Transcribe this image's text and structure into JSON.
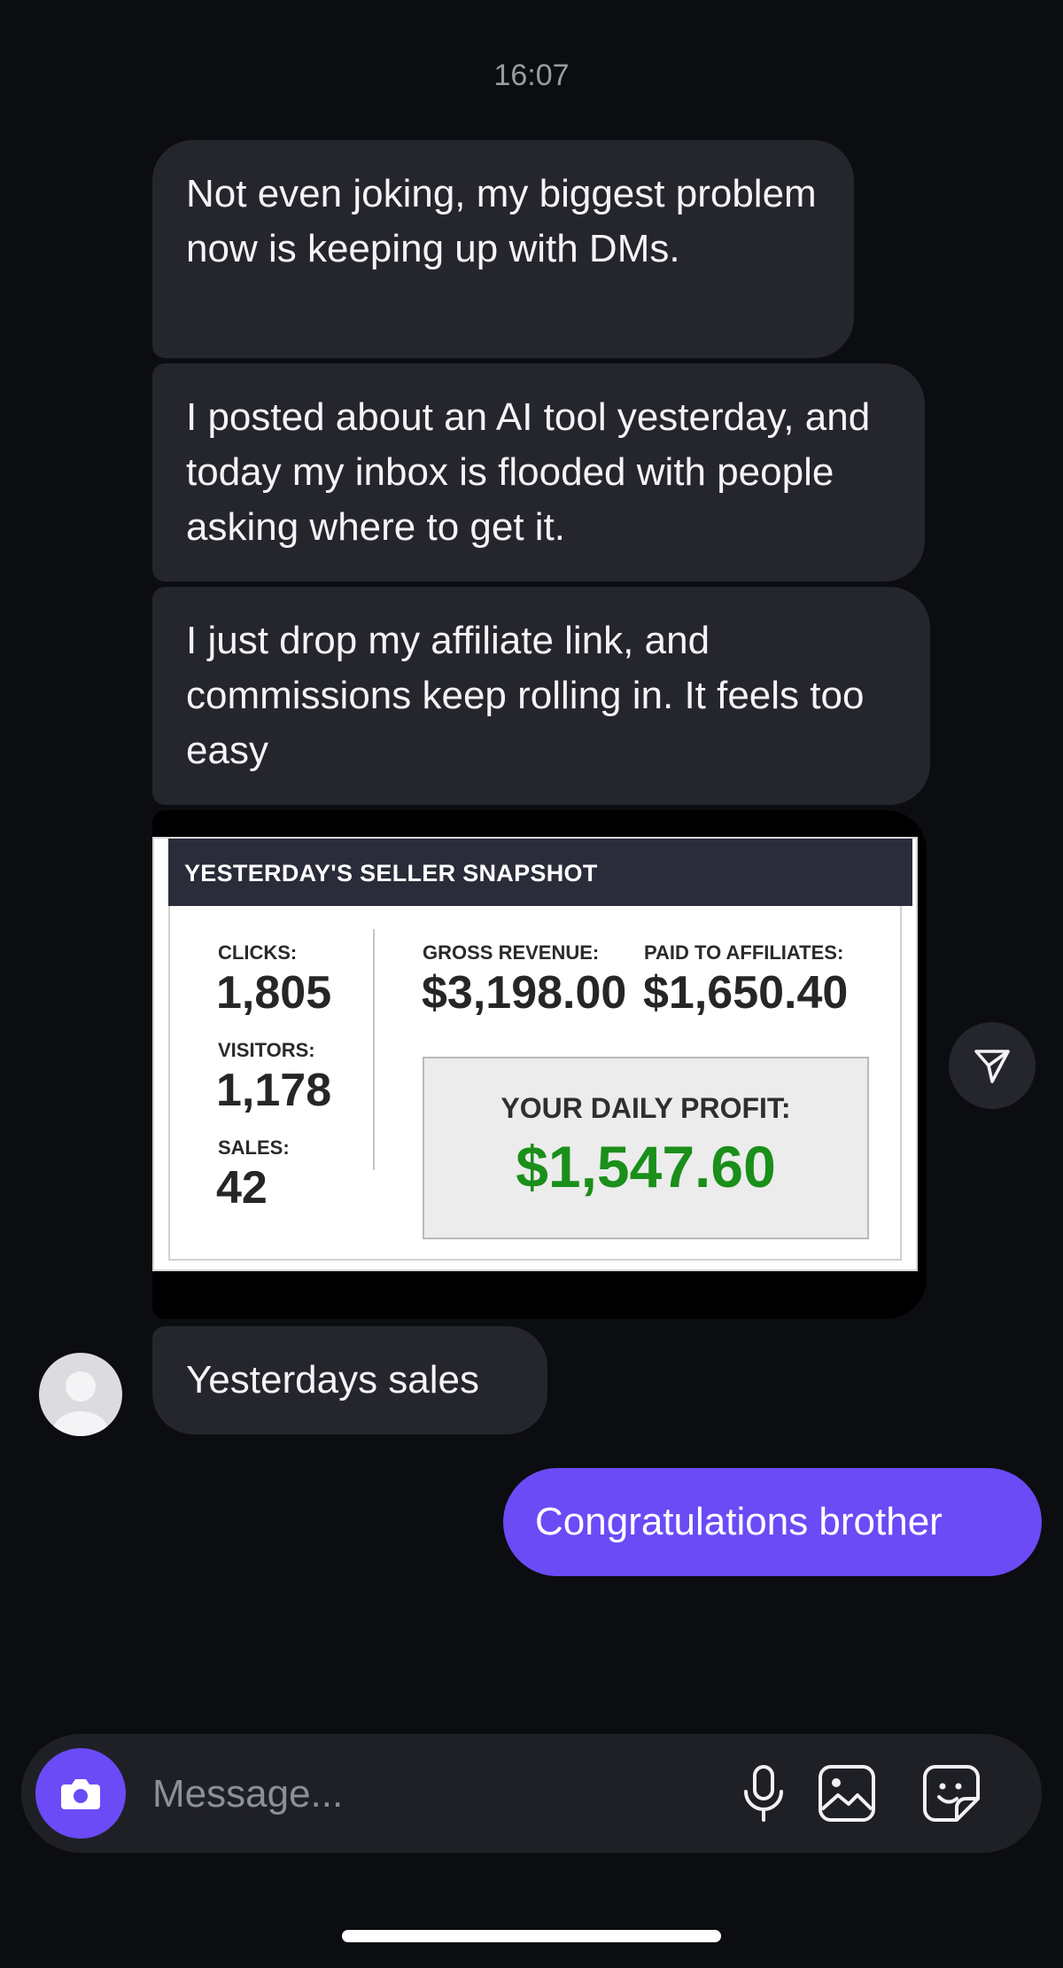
{
  "status": {
    "time": "16:07"
  },
  "messages": [
    {
      "text": "Not even joking, my biggest problem now is keeping up with DMs."
    },
    {
      "text": "I posted about an AI tool yesterday, and today my inbox is flooded with people asking where to get it."
    },
    {
      "text": "I just drop my affiliate link, and commissions keep rolling in. It feels too easy"
    },
    {
      "text": "Yesterdays sales"
    }
  ],
  "snapshot": {
    "title": "YESTERDAY'S SELLER SNAPSHOT",
    "clicks_label": "CLICKS:",
    "clicks": "1,805",
    "visitors_label": "VISITORS:",
    "visitors": "1,178",
    "sales_label": "SALES:",
    "sales": "42",
    "gross_label": "GROSS REVENUE:",
    "gross": "$3,198.00",
    "paid_label": "PAID TO AFFILIATES:",
    "paid": "$1,650.40",
    "profit_label": "YOUR DAILY PROFIT:",
    "profit": "$1,547.60"
  },
  "sent": {
    "text": "Congratulations brother"
  },
  "composer": {
    "placeholder": "Message..."
  },
  "icons": {
    "share": "send-icon",
    "avatar": "avatar-icon",
    "camera": "camera-icon",
    "mic": "microphone-icon",
    "gallery": "image-icon",
    "sticker": "sticker-icon"
  },
  "colors": {
    "background": "#0c0d11",
    "received_bubble": "#25262d",
    "sent_bubble": "#6a4bf6",
    "profit_green": "#1a8f1a"
  }
}
